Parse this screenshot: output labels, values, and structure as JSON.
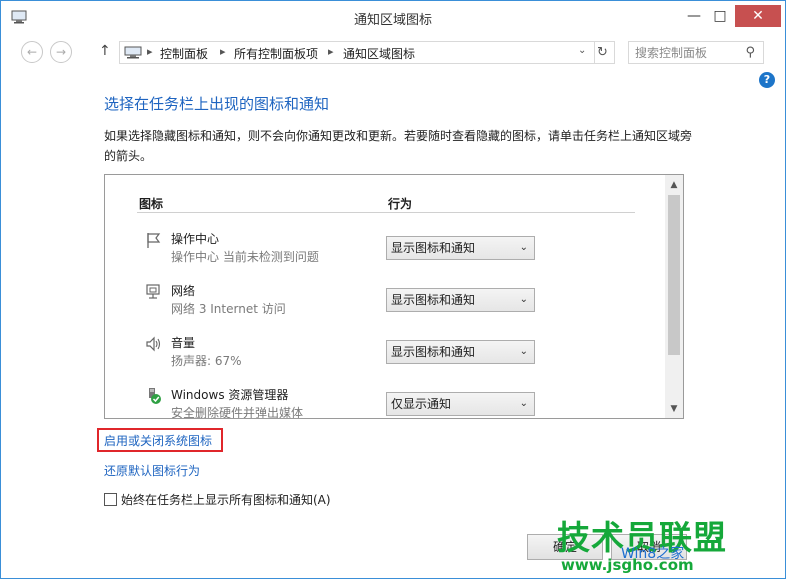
{
  "window": {
    "title": "通知区域图标",
    "minimize": "—",
    "maximize": "□",
    "close": "✕"
  },
  "nav": {
    "breadcrumb": [
      "控制面板",
      "所有控制面板项",
      "通知区域图标"
    ],
    "search_placeholder": "搜索控制面板"
  },
  "main": {
    "title": "选择在任务栏上出现的图标和通知",
    "description": "如果选择隐藏图标和通知，则不会向你通知更改和更新。若要随时查看隐藏的图标，请单击任务栏上通知区域旁的箭头。",
    "table": {
      "col_icon": "图标",
      "col_behavior": "行为",
      "rows": [
        {
          "name": "操作中心",
          "sub": "操作中心  当前未检测到问题",
          "behavior": "显示图标和通知",
          "icon": "flag-icon"
        },
        {
          "name": "网络",
          "sub": "网络  3 Internet 访问",
          "behavior": "显示图标和通知",
          "icon": "network-icon"
        },
        {
          "name": "音量",
          "sub": "扬声器: 67%",
          "behavior": "显示图标和通知",
          "icon": "speaker-icon"
        },
        {
          "name": "Windows 资源管理器",
          "sub": "安全删除硬件并弹出媒体",
          "behavior": "仅显示通知",
          "icon": "usb-eject-icon"
        }
      ]
    },
    "link_system_icons": "启用或关闭系统图标",
    "link_restore": "还原默认图标行为",
    "checkbox_label": "始终在任务栏上显示所有图标和通知(A)",
    "ok_label": "确定",
    "cancel_label": "取消"
  },
  "watermark": {
    "brand": "技术员联盟",
    "site": "www.jsgho.com",
    "logo": "Win8之家",
    "colors": {
      "green": "#15a83a",
      "blue": "#1e6fd0"
    }
  },
  "colors": {
    "accent": "#1e64c0",
    "highlight_box": "#e0262b",
    "close_button": "#c75050"
  }
}
